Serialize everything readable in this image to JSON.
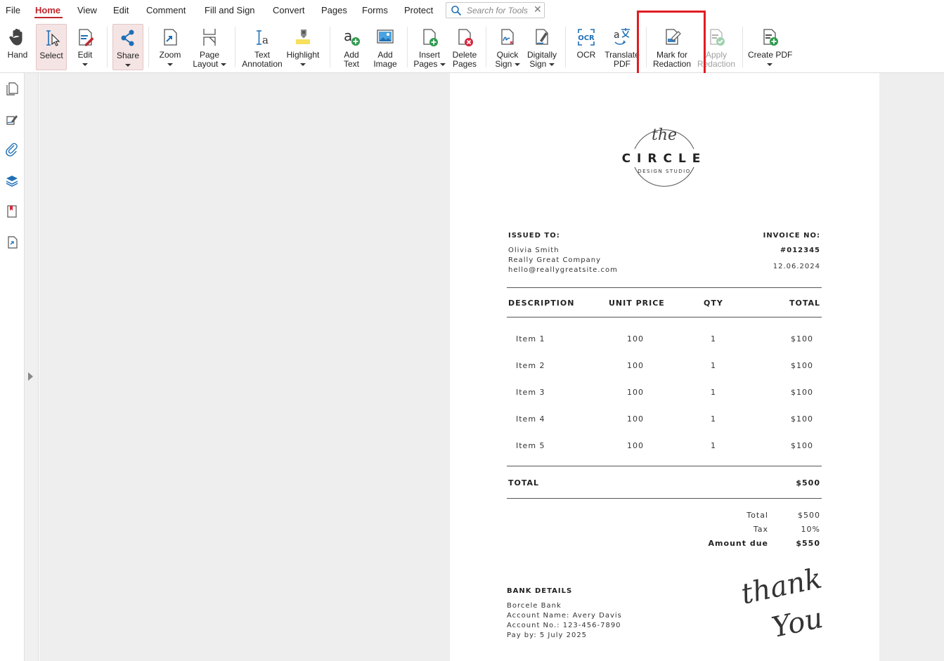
{
  "menu": {
    "items": [
      "File",
      "Home",
      "View",
      "Edit",
      "Comment",
      "Fill and Sign",
      "Convert",
      "Pages",
      "Forms",
      "Protect"
    ],
    "active": "Home",
    "search_placeholder": "Search for Tools"
  },
  "ribbon": {
    "hand": "Hand",
    "select": "Select",
    "edit": "Edit",
    "share": "Share",
    "zoom": "Zoom",
    "page_layout": [
      "Page",
      "Layout"
    ],
    "text_annotation": [
      "Text",
      "Annotation"
    ],
    "highlight": "Highlight",
    "add_text": [
      "Add",
      "Text"
    ],
    "add_image": [
      "Add",
      "Image"
    ],
    "insert_pages": [
      "Insert",
      "Pages"
    ],
    "delete_pages": [
      "Delete",
      "Pages"
    ],
    "quick_sign": [
      "Quick",
      "Sign"
    ],
    "digitally_sign": [
      "Digitally",
      "Sign"
    ],
    "ocr": "OCR",
    "translate_pdf": [
      "Translate",
      "PDF"
    ],
    "mark_for_redaction": [
      "Mark for",
      "Redaction"
    ],
    "apply_redaction": [
      "Apply",
      "Redaction"
    ],
    "create_pdf": "Create PDF"
  },
  "colors": {
    "accent": "#c0262d",
    "highlight_box": "#e11d22",
    "icon_blue": "#1f6fb5",
    "canvas": "#eeeeee"
  },
  "invoice": {
    "logo": {
      "script": "the",
      "name": "CIRCLE",
      "tagline": "DESIGN STUDIO"
    },
    "issued_to_label": "ISSUED TO:",
    "issued_to": [
      "Olivia Smith",
      "Really Great Company",
      "hello@reallygreatsite.com"
    ],
    "invoice_no_label": "INVOICE NO:",
    "invoice_no": "#012345",
    "date": "12.06.2024",
    "columns": [
      "DESCRIPTION",
      "UNIT PRICE",
      "QTY",
      "TOTAL"
    ],
    "rows": [
      [
        "Item 1",
        "100",
        "1",
        "$100"
      ],
      [
        "Item 2",
        "100",
        "1",
        "$100"
      ],
      [
        "Item 3",
        "100",
        "1",
        "$100"
      ],
      [
        "Item 4",
        "100",
        "1",
        "$100"
      ],
      [
        "Item 5",
        "100",
        "1",
        "$100"
      ]
    ],
    "total_label": "TOTAL",
    "total_value": "$500",
    "summary": [
      {
        "label": "Total",
        "value": "$500"
      },
      {
        "label": "Tax",
        "value": "10%"
      },
      {
        "label": "Amount due",
        "value": "$550"
      }
    ],
    "bank_label": "BANK DETAILS",
    "bank": [
      "Borcele Bank",
      "Account Name: Avery Davis",
      "Account No.: 123-456-7890",
      "Pay by: 5 July 2025"
    ],
    "signoff": [
      "thank",
      "You"
    ]
  }
}
